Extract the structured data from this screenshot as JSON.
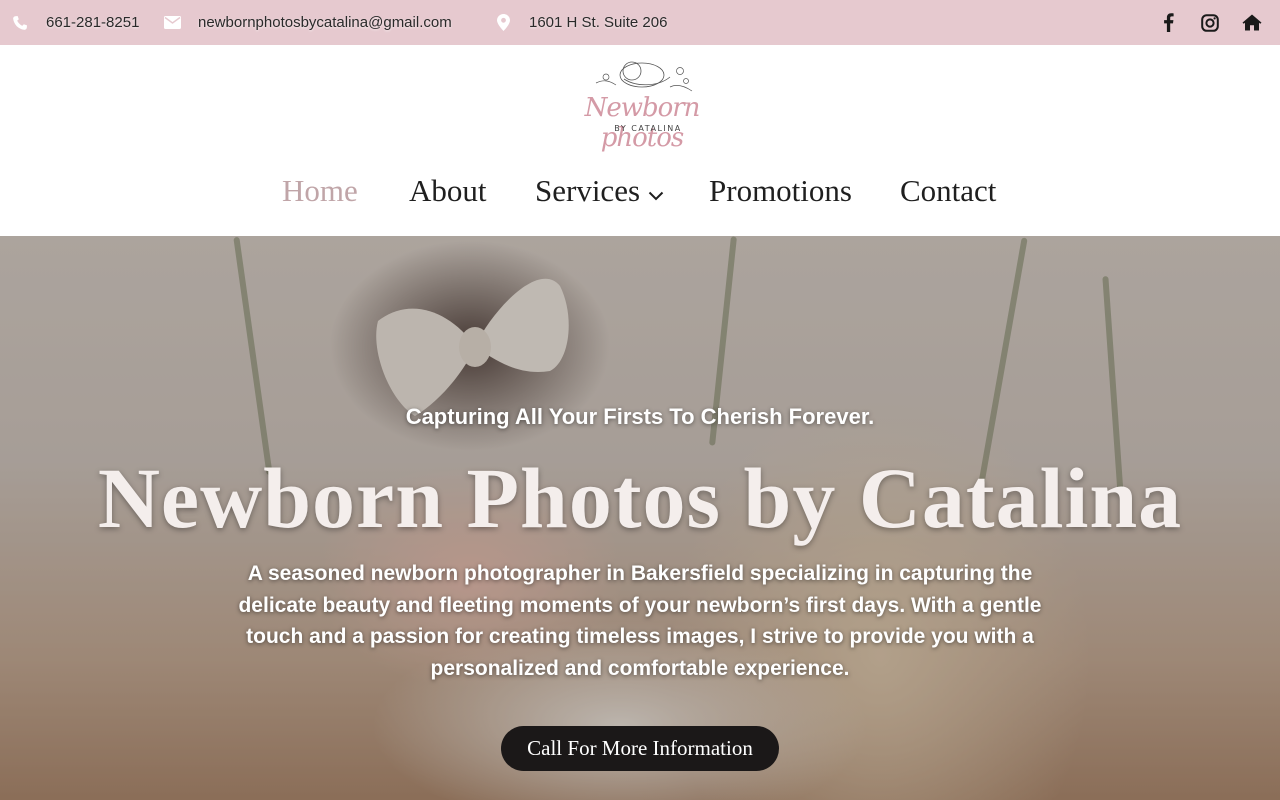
{
  "topbar": {
    "phone": "661-281-8251",
    "email": "newbornphotosbycatalina@gmail.com",
    "address": "1601 H St. Suite 206",
    "social": [
      {
        "icon": "facebook-icon"
      },
      {
        "icon": "instagram-icon"
      },
      {
        "icon": "home-icon"
      }
    ],
    "background": "#e6c9cf"
  },
  "logo": {
    "script": "Newborn photos",
    "sub": "BY CATALINA",
    "color": "#d49aa6"
  },
  "nav": {
    "items": [
      {
        "label": "Home",
        "active": true
      },
      {
        "label": "About"
      },
      {
        "label": "Services",
        "has_dropdown": true
      },
      {
        "label": "Promotions"
      },
      {
        "label": "Contact"
      }
    ],
    "active_color": "#c0a5a8"
  },
  "hero": {
    "tagline": "Capturing All Your Firsts To Cherish Forever.",
    "title": "Newborn Photos by Catalina",
    "description": "A seasoned newborn photographer in Bakersfield specializing in capturing the delicate beauty and fleeting moments of your newborn’s first days. With a gentle touch and a passion for creating timeless images, I strive to provide you with a personalized and comfortable experience.",
    "cta_label": "Call For More Information",
    "cta_color": "#1b1818"
  }
}
